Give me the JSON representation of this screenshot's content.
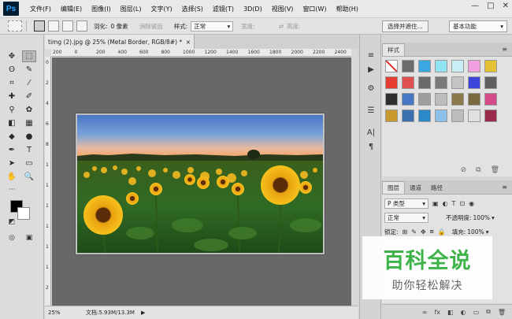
{
  "app": {
    "logo": "Ps"
  },
  "menu": [
    "文件(F)",
    "编辑(E)",
    "图像(I)",
    "图层(L)",
    "文字(Y)",
    "选择(S)",
    "滤镜(T)",
    "3D(D)",
    "视图(V)",
    "窗口(W)",
    "帮助(H)"
  ],
  "window_controls": {
    "minimize": "—",
    "restore": "□",
    "close": "✕"
  },
  "options": {
    "feather_label": "羽化:",
    "feather_value": "0 像素",
    "antialias_label": "消除锯齿",
    "style_label": "样式:",
    "style_value": "正常",
    "width_label": "宽度:",
    "height_label": "高度:",
    "select_mask_button": "选择并遮住...",
    "workspace": "基本功能"
  },
  "document": {
    "tab_title": "timg (2).jpg @ 25% (Metal Border, RGB/8#) *",
    "close": "×",
    "ruler_h": [
      "200",
      "0",
      "200",
      "400",
      "600",
      "800",
      "1000",
      "1200",
      "1400",
      "1600",
      "1800",
      "2000",
      "2200",
      "2400",
      "2600"
    ],
    "ruler_v": [
      "0",
      "2",
      "4",
      "6",
      "8",
      "1",
      "1",
      "1",
      "1",
      "1",
      "1",
      "2"
    ],
    "zoom": "25%",
    "doc_info": "文档:5.93M/13.3M",
    "arrow": "▶"
  },
  "tools": {
    "icons": [
      "move-icon",
      "marquee-icon",
      "lasso-icon",
      "quick-select-icon",
      "crop-icon",
      "eyedropper-icon",
      "healing-icon",
      "brush-icon",
      "stamp-icon",
      "history-brush-icon",
      "eraser-icon",
      "gradient-icon",
      "blur-icon",
      "dodge-icon",
      "pen-icon",
      "type-icon",
      "path-select-icon",
      "rectangle-icon",
      "hand-icon",
      "zoom-icon"
    ],
    "glyphs": [
      "✥",
      "⬚",
      "ʘ",
      "✎",
      "⌗",
      "⁄",
      "✚",
      "✐",
      "⚲",
      "✿",
      "◧",
      "▦",
      "◆",
      "●",
      "✒",
      "T",
      "➤",
      "▭",
      "✋",
      "🔍"
    ],
    "more": "···"
  },
  "strip_icons": [
    "≡",
    "▶",
    "⚙",
    "☰",
    "A|",
    "¶"
  ],
  "styles_panel": {
    "tab": "样式",
    "menu": "≡",
    "swatch_colors": [
      [
        "#ffffff",
        "#6b6b6b",
        "#3aa7e0",
        "#8fe3f0",
        "#c8f0f4",
        "#f0a0e0",
        "#e2c232"
      ],
      [
        "#e63c2f",
        "#e05050",
        "#6a6a6a",
        "#7a7a7a",
        "#c4c4c4",
        "#3b44d9",
        "#5f5f5f"
      ],
      [
        "#2e2e2e",
        "#4778c6",
        "#9e9e9e",
        "#bdbdbd",
        "#8b7a4c",
        "#7a6a40",
        "#d44b8a"
      ],
      [
        "#c89a2f",
        "#3a6fb0",
        "#2c89c9",
        "#8cc0e8",
        "#bcbcbc",
        "#e0e0e0",
        "#9a2a4a"
      ]
    ],
    "footer": [
      "⊘",
      "⧉",
      "🗑"
    ]
  },
  "layers_panel": {
    "tabs": [
      "图层",
      "通道",
      "路径"
    ],
    "menu": "≡",
    "filter_label": "P 类型",
    "blend_mode": "正常",
    "opacity_label": "不透明度:",
    "opacity_value": "100%",
    "lock_label": "锁定:",
    "fill_label": "填充:",
    "fill_value": "100%",
    "filter_icons": [
      "▣",
      "◐",
      "T",
      "⊡",
      "◉"
    ],
    "lock_icons": [
      "⊞",
      "✎",
      "✥",
      "⧈",
      "🔒"
    ],
    "footer": [
      "∞",
      "fx",
      "◧",
      "◐",
      "▭",
      "⧉",
      "🗑"
    ]
  },
  "watermark": {
    "title": "百科全说",
    "subtitle": "助你轻松解决"
  }
}
